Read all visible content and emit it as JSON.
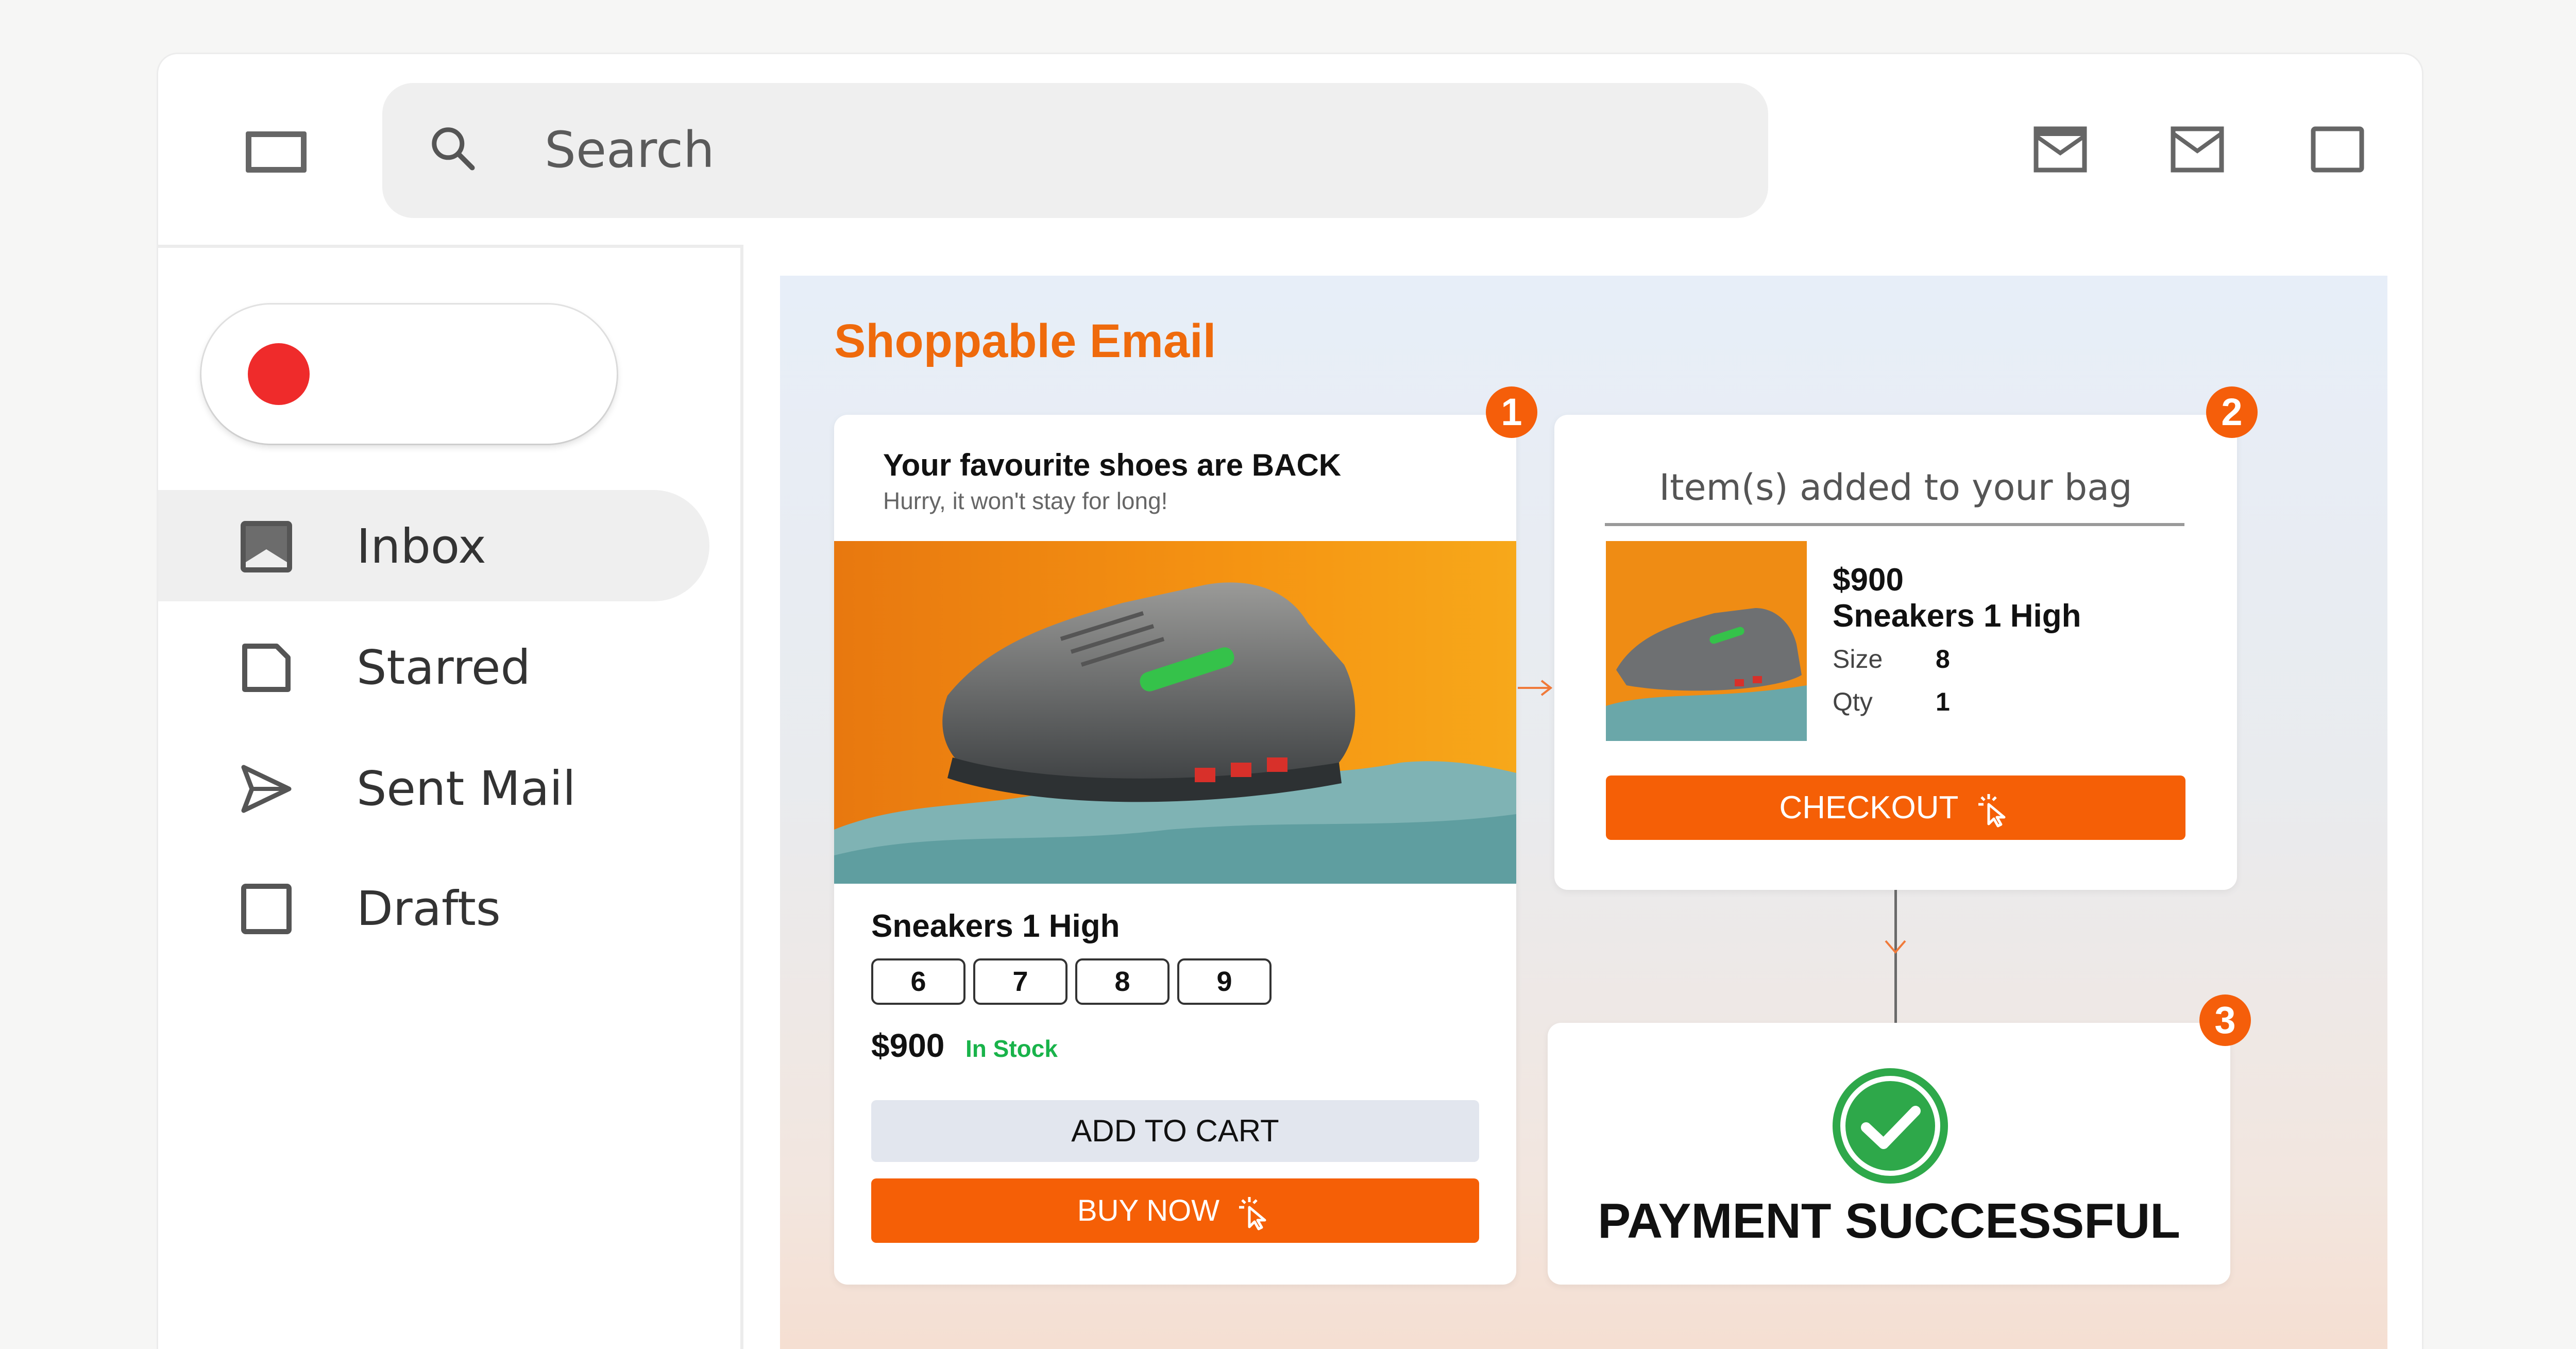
{
  "search": {
    "placeholder": "Search"
  },
  "top_icons": [
    "mail-open-icon",
    "mail-icon",
    "window-icon"
  ],
  "sidebar": {
    "compose_icon": "red-dot",
    "items": [
      {
        "label": "Inbox",
        "icon": "inbox-icon",
        "active": true
      },
      {
        "label": "Starred",
        "icon": "starred-icon",
        "active": false
      },
      {
        "label": "Sent Mail",
        "icon": "send-icon",
        "active": false
      },
      {
        "label": "Drafts",
        "icon": "drafts-icon",
        "active": false
      }
    ]
  },
  "email": {
    "title": "Shoppable Email",
    "step1": {
      "badge": "1",
      "headline": "Your favourite shoes are BACK",
      "subtitle": "Hurry, it won't stay for long!",
      "product_name": "Sneakers 1 High",
      "sizes": [
        "6",
        "7",
        "8",
        "9"
      ],
      "price": "$900",
      "stock": "In Stock",
      "add_to_cart": "ADD TO CART",
      "buy_now": "BUY NOW"
    },
    "step2": {
      "badge": "2",
      "title": "Item(s) added to your bag",
      "price": "$900",
      "product_name": "Sneakers 1 High",
      "size_label": "Size",
      "size_value": "8",
      "qty_label": "Qty",
      "qty_value": "1",
      "checkout": "CHECKOUT"
    },
    "step3": {
      "badge": "3",
      "message": "PAYMENT SUCCESSFUL"
    }
  },
  "colors": {
    "accent": "#f55f06",
    "title_orange": "#ef6a0c",
    "in_stock": "#19b34a",
    "success_green": "#2ea84a",
    "compose_dot": "#ef2b2b"
  }
}
